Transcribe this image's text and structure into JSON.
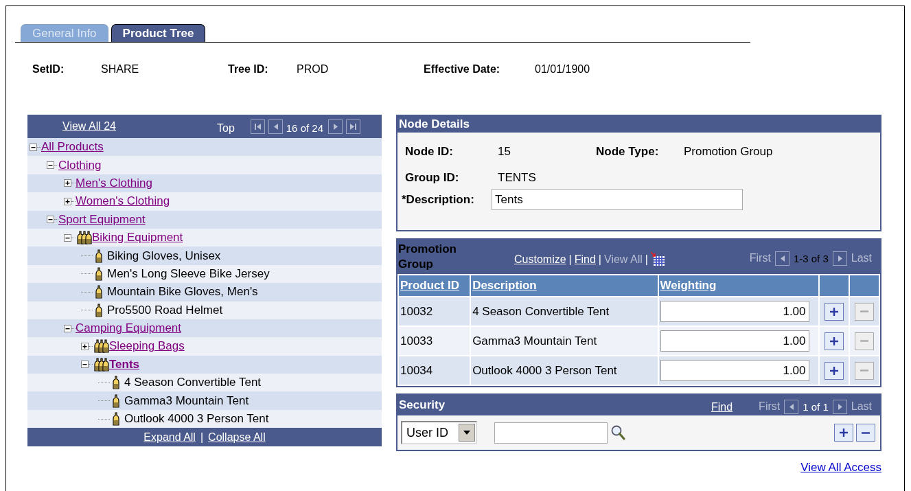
{
  "tabs": [
    {
      "label": "General Info",
      "selected": false
    },
    {
      "label": "Product Tree",
      "selected": true
    }
  ],
  "header": [
    {
      "label": "SetID:",
      "value": "SHARE"
    },
    {
      "label": "Tree ID:",
      "value": "PROD"
    },
    {
      "label": "Effective Date:",
      "value": "01/01/1900"
    }
  ],
  "tree": {
    "view_all": "View All 24",
    "top": "Top",
    "position": "16 of 24",
    "nodes": [
      {
        "kind": "folder",
        "label": "All Products",
        "expanded": true,
        "selected": false,
        "children": [
          {
            "kind": "folder",
            "label": "Clothing",
            "expanded": true,
            "selected": false,
            "children": [
              {
                "kind": "folder",
                "label": "Men's Clothing",
                "expanded": false,
                "selected": false
              },
              {
                "kind": "folder",
                "label": "Women's Clothing",
                "expanded": false,
                "selected": false
              }
            ]
          },
          {
            "kind": "folder",
            "label": "Sport Equipment",
            "expanded": true,
            "selected": false,
            "children": [
              {
                "kind": "group",
                "label": "Biking Equipment",
                "expanded": true,
                "selected": false,
                "children": [
                  {
                    "kind": "item",
                    "label": "Biking Gloves, Unisex",
                    "selected": false
                  },
                  {
                    "kind": "item",
                    "label": "Men's Long Sleeve Bike Jersey",
                    "selected": false
                  },
                  {
                    "kind": "item",
                    "label": "Mountain Bike Gloves, Men's",
                    "selected": false
                  },
                  {
                    "kind": "item",
                    "label": "Pro5500 Road Helmet",
                    "selected": false
                  }
                ]
              },
              {
                "kind": "folder",
                "label": "Camping Equipment",
                "expanded": true,
                "selected": false,
                "children": [
                  {
                    "kind": "group",
                    "label": "Sleeping Bags",
                    "expanded": false,
                    "selected": false
                  },
                  {
                    "kind": "group",
                    "label": "Tents",
                    "expanded": true,
                    "selected": true,
                    "children": [
                      {
                        "kind": "item",
                        "label": "4 Season Convertible Tent",
                        "selected": false
                      },
                      {
                        "kind": "item",
                        "label": "Gamma3 Mountain Tent",
                        "selected": false
                      },
                      {
                        "kind": "item",
                        "label": "Outlook 4000 3 Person Tent",
                        "selected": false
                      }
                    ]
                  }
                ]
              }
            ]
          }
        ]
      }
    ],
    "expand_all": "Expand All",
    "separator": "|",
    "collapse_all": "Collapse All"
  },
  "node_details": {
    "title": "Node Details",
    "fields": [
      {
        "label": "Node ID:",
        "value": "15"
      },
      {
        "label": "Node Type:",
        "value": "Promotion Group"
      },
      {
        "label": "Group ID:",
        "value": "TENTS"
      }
    ],
    "description": {
      "label": "*Description:",
      "value": "Tents"
    }
  },
  "promotion_group": {
    "title": "Promotion Group",
    "links": [
      {
        "label": "Customize",
        "disabled": false
      },
      {
        "label": "Find",
        "disabled": false
      },
      {
        "label": "View All",
        "disabled": true
      }
    ],
    "separator": "|",
    "first": {
      "label": "First",
      "disabled": true
    },
    "count": "1-3 of 3",
    "last": {
      "label": "Last",
      "disabled": true
    },
    "columns": [
      "Product ID",
      "Description",
      "Weighting"
    ],
    "rows": [
      {
        "product_id": "10032",
        "description": "4 Season Convertible Tent",
        "weighting": "1.00",
        "can_remove": false
      },
      {
        "product_id": "10033",
        "description": "Gamma3 Mountain Tent",
        "weighting": "1.00",
        "can_remove": false
      },
      {
        "product_id": "10034",
        "description": "Outlook 4000 3 Person Tent",
        "weighting": "1.00",
        "can_remove": false
      }
    ]
  },
  "security": {
    "title": "Security",
    "find": "Find",
    "first": {
      "label": "First",
      "disabled": true
    },
    "count": "1 of 1",
    "last": {
      "label": "Last",
      "disabled": true
    },
    "select": "User ID",
    "can_remove": true
  },
  "view_all_access": "View All Access"
}
